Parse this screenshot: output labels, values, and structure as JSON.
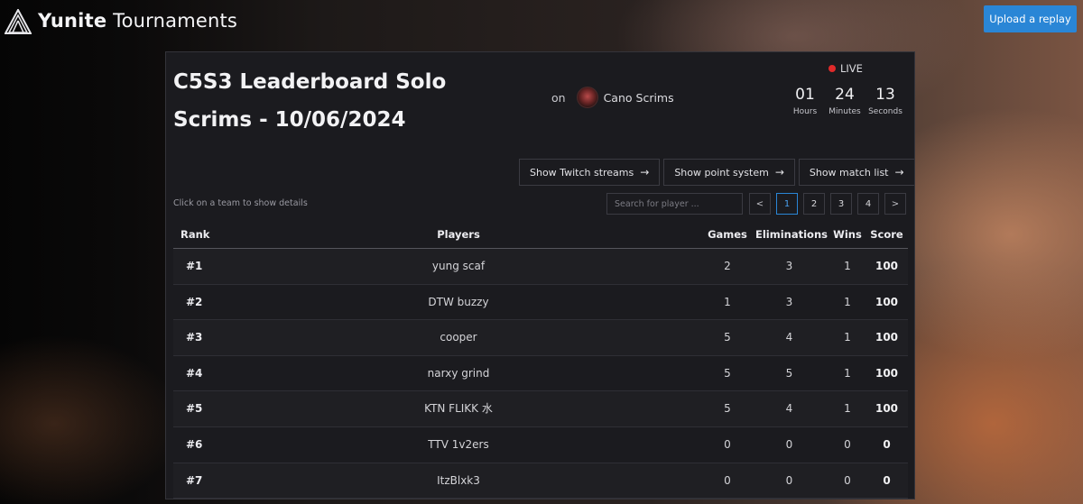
{
  "brand": {
    "name_bold": "Yunite",
    "name_rest": " Tournaments"
  },
  "header": {
    "upload_label": "Upload a replay"
  },
  "tournament": {
    "title": "C5S3 Leaderboard Solo Scrims - 10/06/2024",
    "on_label": "on",
    "organizer": "Cano Scrims",
    "status": "LIVE",
    "countdown": [
      {
        "value": "01",
        "label": "Hours"
      },
      {
        "value": "24",
        "label": "Minutes"
      },
      {
        "value": "13",
        "label": "Seconds"
      }
    ]
  },
  "actions": [
    {
      "label": "Show Twitch streams",
      "icon": "arrow-right-icon"
    },
    {
      "label": "Show point system",
      "icon": "arrow-right-icon"
    },
    {
      "label": "Show match list",
      "icon": "arrow-right-icon"
    }
  ],
  "hint": "Click on a team to show details",
  "search": {
    "placeholder": "Search for player ..."
  },
  "pagination": {
    "prev": "<",
    "next": ">",
    "pages": [
      "1",
      "2",
      "3",
      "4"
    ],
    "current": "1"
  },
  "table": {
    "columns": {
      "rank": "Rank",
      "players": "Players",
      "games": "Games",
      "eliminations": "Eliminations",
      "wins": "Wins",
      "score": "Score"
    },
    "rows": [
      {
        "rank": "#1",
        "player": "yung scaf",
        "games": "2",
        "eliminations": "3",
        "wins": "1",
        "score": "100"
      },
      {
        "rank": "#2",
        "player": "DTW buzzy",
        "games": "1",
        "eliminations": "3",
        "wins": "1",
        "score": "100"
      },
      {
        "rank": "#3",
        "player": "cooper",
        "games": "5",
        "eliminations": "4",
        "wins": "1",
        "score": "100"
      },
      {
        "rank": "#4",
        "player": "narxy grind",
        "games": "5",
        "eliminations": "5",
        "wins": "1",
        "score": "100"
      },
      {
        "rank": "#5",
        "player": "KTN FLIKK 水",
        "games": "5",
        "eliminations": "4",
        "wins": "1",
        "score": "100"
      },
      {
        "rank": "#6",
        "player": "TTV 1v2ers",
        "games": "0",
        "eliminations": "0",
        "wins": "0",
        "score": "0"
      },
      {
        "rank": "#7",
        "player": "ItzBlxk3",
        "games": "0",
        "eliminations": "0",
        "wins": "0",
        "score": "0"
      }
    ]
  },
  "colors": {
    "accent": "#2a86d6",
    "live": "#e02a2a",
    "panel": "#1b1b1f"
  }
}
